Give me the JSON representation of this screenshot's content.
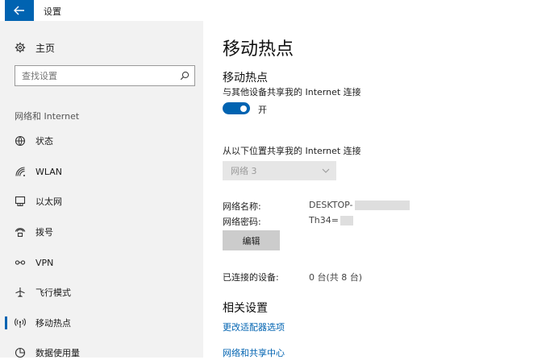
{
  "window": {
    "title": "设置"
  },
  "sidebar": {
    "home_label": "主页",
    "search_placeholder": "查找设置",
    "section_label": "网络和 Internet",
    "items": [
      {
        "label": "状态",
        "icon": "globe-icon"
      },
      {
        "label": "WLAN",
        "icon": "wifi-icon"
      },
      {
        "label": "以太网",
        "icon": "ethernet-icon"
      },
      {
        "label": "拨号",
        "icon": "dialup-icon"
      },
      {
        "label": "VPN",
        "icon": "vpn-icon"
      },
      {
        "label": "飞行模式",
        "icon": "airplane-icon"
      },
      {
        "label": "移动热点",
        "icon": "hotspot-icon",
        "active": true
      },
      {
        "label": "数据使用量",
        "icon": "data-usage-icon"
      }
    ]
  },
  "main": {
    "page_title": "移动热点",
    "hotspot": {
      "heading": "移动热点",
      "description": "与其他设备共享我的 Internet 连接",
      "toggle_state": "开"
    },
    "share_from": {
      "label": "从以下位置共享我的 Internet 连接",
      "selected": "网络 3"
    },
    "network_name": {
      "label": "网络名称:",
      "value": "DESKTOP-"
    },
    "network_password": {
      "label": "网络密码:",
      "value": "Th34="
    },
    "edit_label": "编辑",
    "connected": {
      "label": "已连接的设备:",
      "value": "0 台(共 8 台)"
    },
    "related": {
      "heading": "相关设置",
      "links": [
        "更改适配器选项",
        "网络和共享中心"
      ]
    }
  },
  "colors": {
    "accent": "#0063b1",
    "sidebar_bg": "#f2f2f2"
  }
}
